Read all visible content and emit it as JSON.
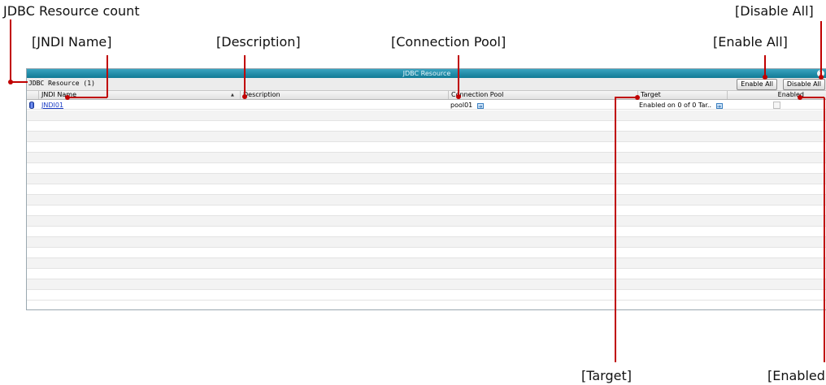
{
  "callouts": {
    "count": "JDBC Resource count",
    "jndi": "[JNDI Name]",
    "description": "[Description]",
    "connection_pool": "[Connection Pool]",
    "enable_all": "[Enable All]",
    "disable_all": "[Disable All]",
    "target": "[Target]",
    "enabled": "[Enabled]"
  },
  "window": {
    "title": "JDBC Resource",
    "help": "?"
  },
  "toolbar": {
    "count_label": "JDBC Resource (1)",
    "enable_all": "Enable All",
    "disable_all": "Disable All"
  },
  "table": {
    "columns": {
      "jndi": "JNDI Name",
      "description": "Description",
      "connection_pool": "Connection Pool",
      "target": "Target",
      "enabled": "Enabled"
    },
    "sort_indicator": "▲",
    "rows": [
      {
        "jndi": "JNDI01",
        "description": "",
        "pool": "pool01",
        "target": "Enabled on 0 of 0 Tar..",
        "enabled": false
      }
    ]
  },
  "colors": {
    "annotation": "#c00000",
    "titlebar": "#107a95",
    "link": "#1a3cc4"
  }
}
